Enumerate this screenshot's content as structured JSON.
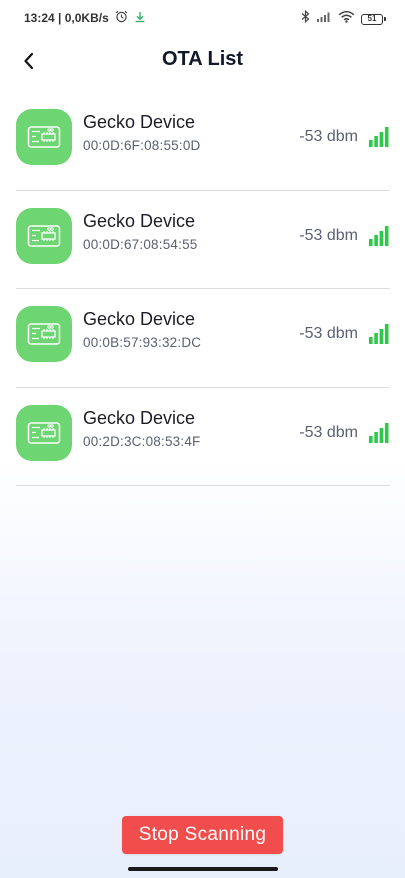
{
  "status_bar": {
    "time_speed": "13:24 | 0,0KB/s",
    "battery": "51",
    "icons": [
      "alarm-icon",
      "download-icon",
      "bluetooth-icon",
      "cellular-signal-icon",
      "wifi-icon",
      "battery-icon"
    ]
  },
  "header": {
    "title": "OTA List",
    "back_icon": "chevron-left-icon"
  },
  "devices": [
    {
      "name": "Gecko Device",
      "mac": "00:0D:6F:08:55:0D",
      "rssi": "-53 dbm",
      "signal_level": 4
    },
    {
      "name": "Gecko Device",
      "mac": "00:0D:67:08:54:55",
      "rssi": "-53 dbm",
      "signal_level": 4
    },
    {
      "name": "Gecko Device",
      "mac": "00:0B:57:93:32:DC",
      "rssi": "-53 dbm",
      "signal_level": 4
    },
    {
      "name": "Gecko Device",
      "mac": "00:2D:3C:08:53:4F",
      "rssi": "-53 dbm",
      "signal_level": 4
    }
  ],
  "footer": {
    "stop_label": "Stop Scanning"
  },
  "colors": {
    "device_icon_bg": "#6dd571",
    "signal": "#2fc84a",
    "stop_button": "#f14d4d",
    "title": "#111827"
  }
}
